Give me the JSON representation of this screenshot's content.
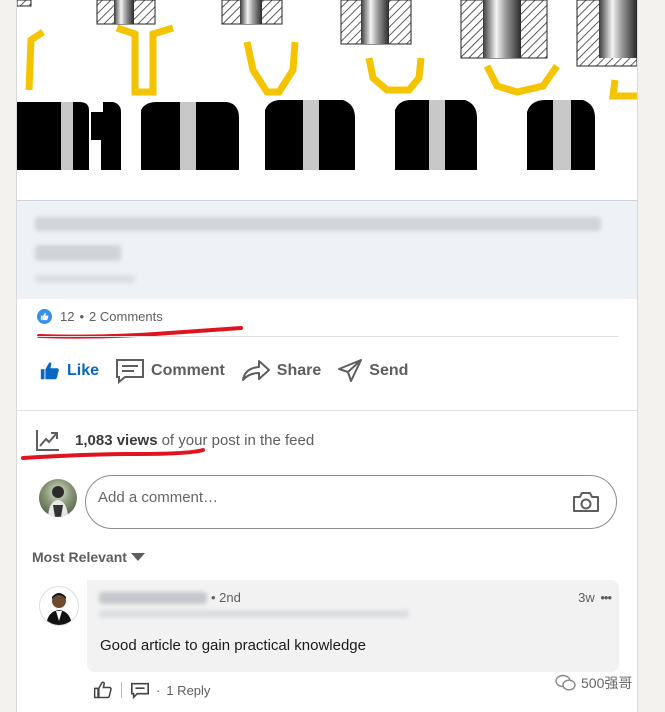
{
  "post": {
    "image_alt": "die punch diagram",
    "social_counts": {
      "reactions": "12",
      "separator": "•",
      "comments": "2 Comments"
    }
  },
  "actions": [
    {
      "label": "Like",
      "icon": "thumbs-up-icon"
    },
    {
      "label": "Comment",
      "icon": "comment-icon"
    },
    {
      "label": "Share",
      "icon": "share-arrow-icon"
    },
    {
      "label": "Send",
      "icon": "send-icon"
    }
  ],
  "views": {
    "count_label": "1,083 views",
    "suffix": "of your post in the feed",
    "icon": "analytics-icon"
  },
  "comment_box": {
    "placeholder": "Add a comment…",
    "icon": "camera-icon"
  },
  "sort": {
    "label": "Most Relevant"
  },
  "comments": [
    {
      "degree": "• 2nd",
      "time": "3w",
      "more": "•••",
      "text": "Good article to gain practical knowledge",
      "reply_label": "1 Reply",
      "dot": "·"
    }
  ],
  "watermark": {
    "text": "500强哥"
  },
  "colors": {
    "brand_blue": "#0a66c2",
    "reaction_blue": "#378fe9",
    "annotation_red": "#e0141e",
    "die_yellow": "#f5c400"
  }
}
